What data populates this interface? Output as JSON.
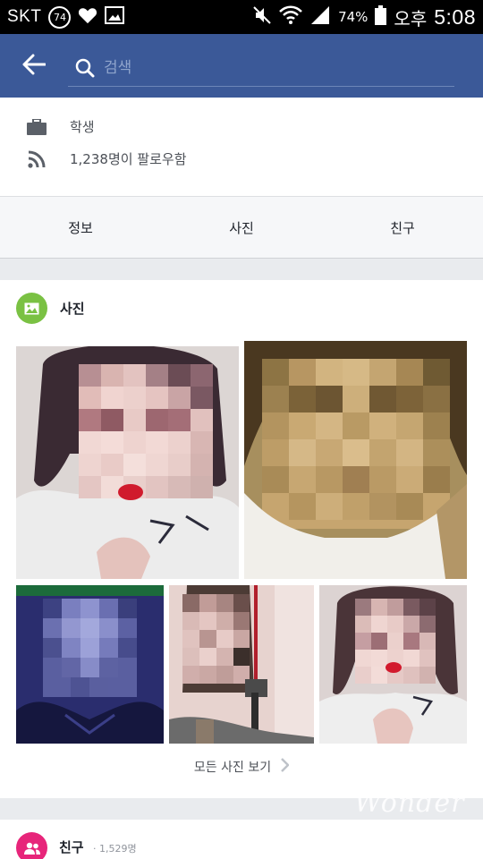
{
  "status_bar": {
    "carrier": "SKT",
    "badge": "74",
    "battery_percent": "74%",
    "ampm": "오후",
    "time": "5:08",
    "icons": [
      "heart-icon",
      "image-icon",
      "mute-icon",
      "wifi-icon",
      "signal-icon",
      "battery-icon"
    ]
  },
  "app_bar": {
    "back_icon": "back-arrow-icon",
    "search_icon": "search-icon",
    "search_placeholder": "검색",
    "color": "#3b5998"
  },
  "info": {
    "work": {
      "icon": "briefcase-icon",
      "text": "학생"
    },
    "followers": {
      "icon": "rss-icon",
      "text": "1,238명이 팔로우함"
    }
  },
  "tabs": [
    {
      "label": "정보"
    },
    {
      "label": "사진"
    },
    {
      "label": "친구"
    }
  ],
  "photos": {
    "icon": "photos-icon",
    "title": "사진",
    "see_all": "모든 사진 보기",
    "see_all_icon": "chevron-right-icon",
    "items": [
      {
        "alt": "pixelated profile photo 1"
      },
      {
        "alt": "pixelated profile photo 2"
      },
      {
        "alt": "pixelated profile photo 3"
      },
      {
        "alt": "pixelated profile photo 4"
      },
      {
        "alt": "pixelated profile photo 5"
      }
    ]
  },
  "friends": {
    "icon": "friends-icon",
    "title": "친구",
    "count": "· 1,529명"
  },
  "watermark": "Wonder"
}
